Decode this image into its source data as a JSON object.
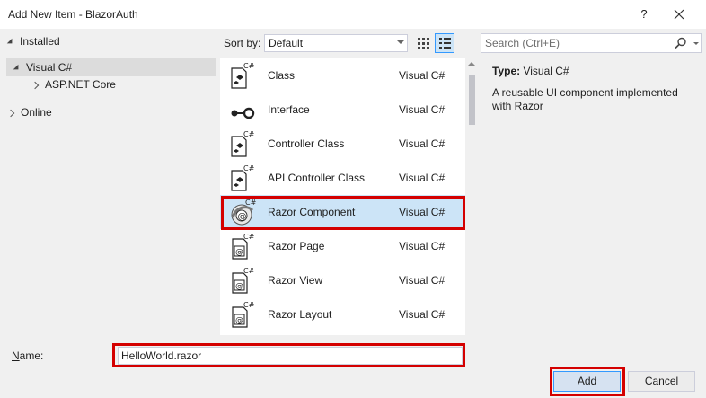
{
  "window": {
    "title": "Add New Item - BlazorAuth",
    "help_label": "?"
  },
  "tree": {
    "installed": "Installed",
    "visual_csharp": "Visual C#",
    "aspnet_core": "ASP.NET Core",
    "online": "Online"
  },
  "toolbar": {
    "sort_by_label": "Sort by:",
    "sort_value": "Default",
    "search_placeholder": "Search (Ctrl+E)"
  },
  "items": [
    {
      "name": "Class",
      "lang": "Visual C#",
      "icon": "class-file-icon"
    },
    {
      "name": "Interface",
      "lang": "Visual C#",
      "icon": "interface-icon"
    },
    {
      "name": "Controller Class",
      "lang": "Visual C#",
      "icon": "controller-class-icon"
    },
    {
      "name": "API Controller Class",
      "lang": "Visual C#",
      "icon": "api-controller-icon"
    },
    {
      "name": "Razor Component",
      "lang": "Visual C#",
      "icon": "razor-component-icon",
      "selected": true
    },
    {
      "name": "Razor Page",
      "lang": "Visual C#",
      "icon": "razor-page-icon"
    },
    {
      "name": "Razor View",
      "lang": "Visual C#",
      "icon": "razor-view-icon"
    },
    {
      "name": "Razor Layout",
      "lang": "Visual C#",
      "icon": "razor-layout-icon"
    }
  ],
  "details": {
    "type_label": "Type:",
    "type_value": "Visual C#",
    "description": "A reusable UI component implemented with Razor"
  },
  "footer": {
    "name_label_mnemonic": "N",
    "name_label_rest": "ame:",
    "name_value": "HelloWorld.razor",
    "add_label": "Add",
    "cancel_label": "Cancel"
  },
  "colors": {
    "dialog_bg": "#f0f0f0",
    "selection": "#cce4f7",
    "highlight_border": "#d40000",
    "accent": "#3399ff"
  }
}
